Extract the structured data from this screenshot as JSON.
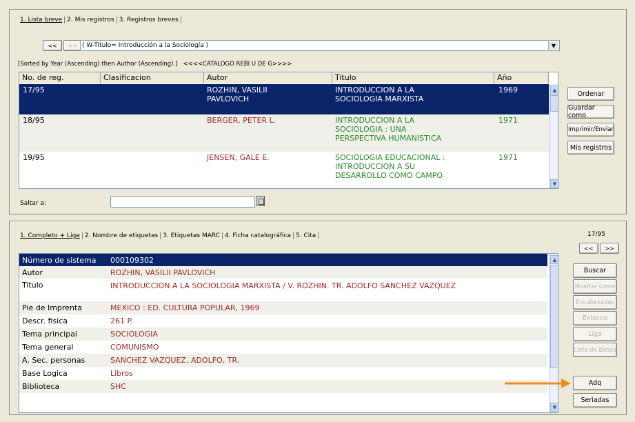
{
  "top": {
    "tabs": [
      "1. Lista breve",
      "2. Mis registros",
      "3. Registros breves"
    ],
    "nav_prev": "<<",
    "nav_next": ">>",
    "query": "( W-Titulo= Introducción a la Sociología )",
    "sort_info": "[Sorted by Year (Ascending) then Author (Ascending).]   <<<<CATALOGO REBI U DE G>>>>",
    "columns": [
      "No. de reg.",
      "Clasificacion",
      "Autor",
      "Titulo",
      "Año"
    ],
    "rows": [
      {
        "reg": "17/95",
        "clas": "",
        "autor": "ROZHIN, VASILII PAVLOVICH",
        "titulo": "INTRODUCCION A LA SOCIOLOGIA MARXISTA",
        "anio": "1969"
      },
      {
        "reg": "18/95",
        "clas": "",
        "autor": "BERGER, PETER L.",
        "titulo": "INTRODUCCION A LA SOCIOLOGIA : UNA PERSPECTIVA HUMANISTICA",
        "anio": "1971"
      },
      {
        "reg": "19/95",
        "clas": "",
        "autor": "JENSEN, GALE E.",
        "titulo": "SOCIOLOGIA EDUCACIONAL : INTRODUCCION A SU DESARROLLO COMO CAMPO",
        "anio": "1971"
      }
    ],
    "jump_label": "Saltar a:",
    "jump_value": "",
    "buttons": {
      "ordenar": "Ordenar",
      "guardar": "Guardar como",
      "imprimir": "Imprimir/Enviar",
      "mis_registros": "Mis registros"
    }
  },
  "bottom": {
    "tabs": [
      "1. Completo + Liga",
      "2. Nombre de etiquetas",
      "3. Etiquetas MARC",
      "4. Ficha catalográfica",
      "5. Cita"
    ],
    "record_counter": "17/95",
    "nav_prev": "<<",
    "nav_next": ">>",
    "fields": [
      {
        "label": "Número de sistema",
        "value": "000109302"
      },
      {
        "label": "Autor",
        "value": "ROZHIN, VASILII PAVLOVICH"
      },
      {
        "label": "Titulo",
        "value": "INTRODUCCION A LA SOCIOLOGIA MARXISTA / V. ROZHIN. TR. ADOLFO SANCHEZ VAZQUEZ"
      },
      {
        "label": "Pie de Imprenta",
        "value": "MEXICO : ED. CULTURA POPULAR, 1969"
      },
      {
        "label": "Descr. fisica",
        "value": "261 P."
      },
      {
        "label": "Tema principal",
        "value": "SOCIOLOGIA"
      },
      {
        "label": "Tema general",
        "value": "COMUNISMO"
      },
      {
        "label": "A. Sec. personas",
        "value": "SANCHEZ VAZQUEZ, ADOLFO, TR."
      },
      {
        "label": "Base Logica",
        "value": "Libros"
      },
      {
        "label": "Biblioteca",
        "value": "SHC"
      }
    ],
    "buttons": {
      "buscar": "Buscar",
      "mostrar": "Mostrar como",
      "encabezados": "Encabezados",
      "externo": "Externo",
      "liga": "Liga",
      "lista_bases": "Lista de Bases",
      "adq": "Adq",
      "seriadas": "Seriadas"
    }
  },
  "colors": {
    "selected_row": "#0a246a",
    "accent_red": "#a12a2a",
    "accent_green": "#2a8a2a",
    "arrow_orange": "#f08c1e"
  }
}
